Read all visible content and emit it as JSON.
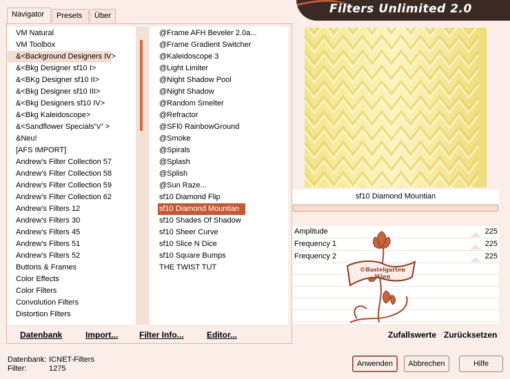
{
  "tabs": [
    {
      "label": "Navigator"
    },
    {
      "label": "Presets"
    },
    {
      "label": "Über"
    }
  ],
  "title": "Filters Unlimited 2.0",
  "categories": [
    "VM Natural",
    "VM Toolbox",
    "&<Background Designers IV>",
    "&<Bkg Designer sf10 I>",
    "&<BKg Designer sf10 II>",
    "&<Bkg Designer sf10 III>",
    "&<Bkg Designers sf10 IV>",
    "&<Bkg Kaleidoscope>",
    "&<Sandflower Specials\"v\" >",
    "&Neu!",
    "[AFS IMPORT]",
    "Andrew's Filter Collection 57",
    "Andrew's Filter Collection 58",
    "Andrew's Filter Collection 59",
    "Andrew's Filter Collection 62",
    "Andrew's Filters 12",
    "Andrew's Filters 30",
    "Andrew's Filters 45",
    "Andrew's Filters 51",
    "Andrew's Filters 52",
    "Buttons & Frames",
    "Color Effects",
    "Color Filters",
    "Convolution Filters",
    "Distortion Filters"
  ],
  "filters": [
    "@Frame AFH Beveler 2.0a...",
    "@Frame Gradient Switcher",
    "@Kaleidoscope 3",
    "@Light Limiter",
    "@Night Shadow Pool",
    "@Night Shadow",
    "@Random Smelter",
    "@Refractor",
    "@SFl0 RainbowGround",
    "@Smoke",
    "@Spirals",
    "@Splash",
    "@Splish",
    "@Sun Raze...",
    "sf10 Diamond Flip",
    "sf10 Diamond Mountian",
    "sf10 Shades Of Shadow",
    "sf10 Sheer Curve",
    "sf10 Slice N Dice",
    "sf10 Square Bumps",
    "THE TWIST TUT"
  ],
  "panel_buttons": {
    "datenbank": "Datenbank",
    "import": "Import...",
    "filter_info": "Filter Info...",
    "editor": "Editor..."
  },
  "preview": {
    "filter_name": "sf10 Diamond Mountian",
    "image_color": "#f5e99a"
  },
  "params": [
    {
      "label": "Amplitude",
      "value": "225"
    },
    {
      "label": "Frequency 1",
      "value": "225"
    },
    {
      "label": "Frequency 2",
      "value": "225"
    }
  ],
  "logo": {
    "line1": "©Bastelgarten",
    "line2": "Wien"
  },
  "preview_buttons": {
    "random": "Zufallswerte",
    "reset": "Zurücksetzen"
  },
  "status": {
    "db_label": "Datenbank:",
    "db_value": "ICNET-Filters",
    "filter_label": "Filter:",
    "filter_value": "1275"
  },
  "dialog_buttons": {
    "apply": "Anwenden",
    "cancel": "Abbrechen",
    "help": "Hilfe"
  },
  "colors": {
    "accent": "#c45a35",
    "title_bg": "#3a2a24",
    "window_bg": "#fbeee8"
  }
}
